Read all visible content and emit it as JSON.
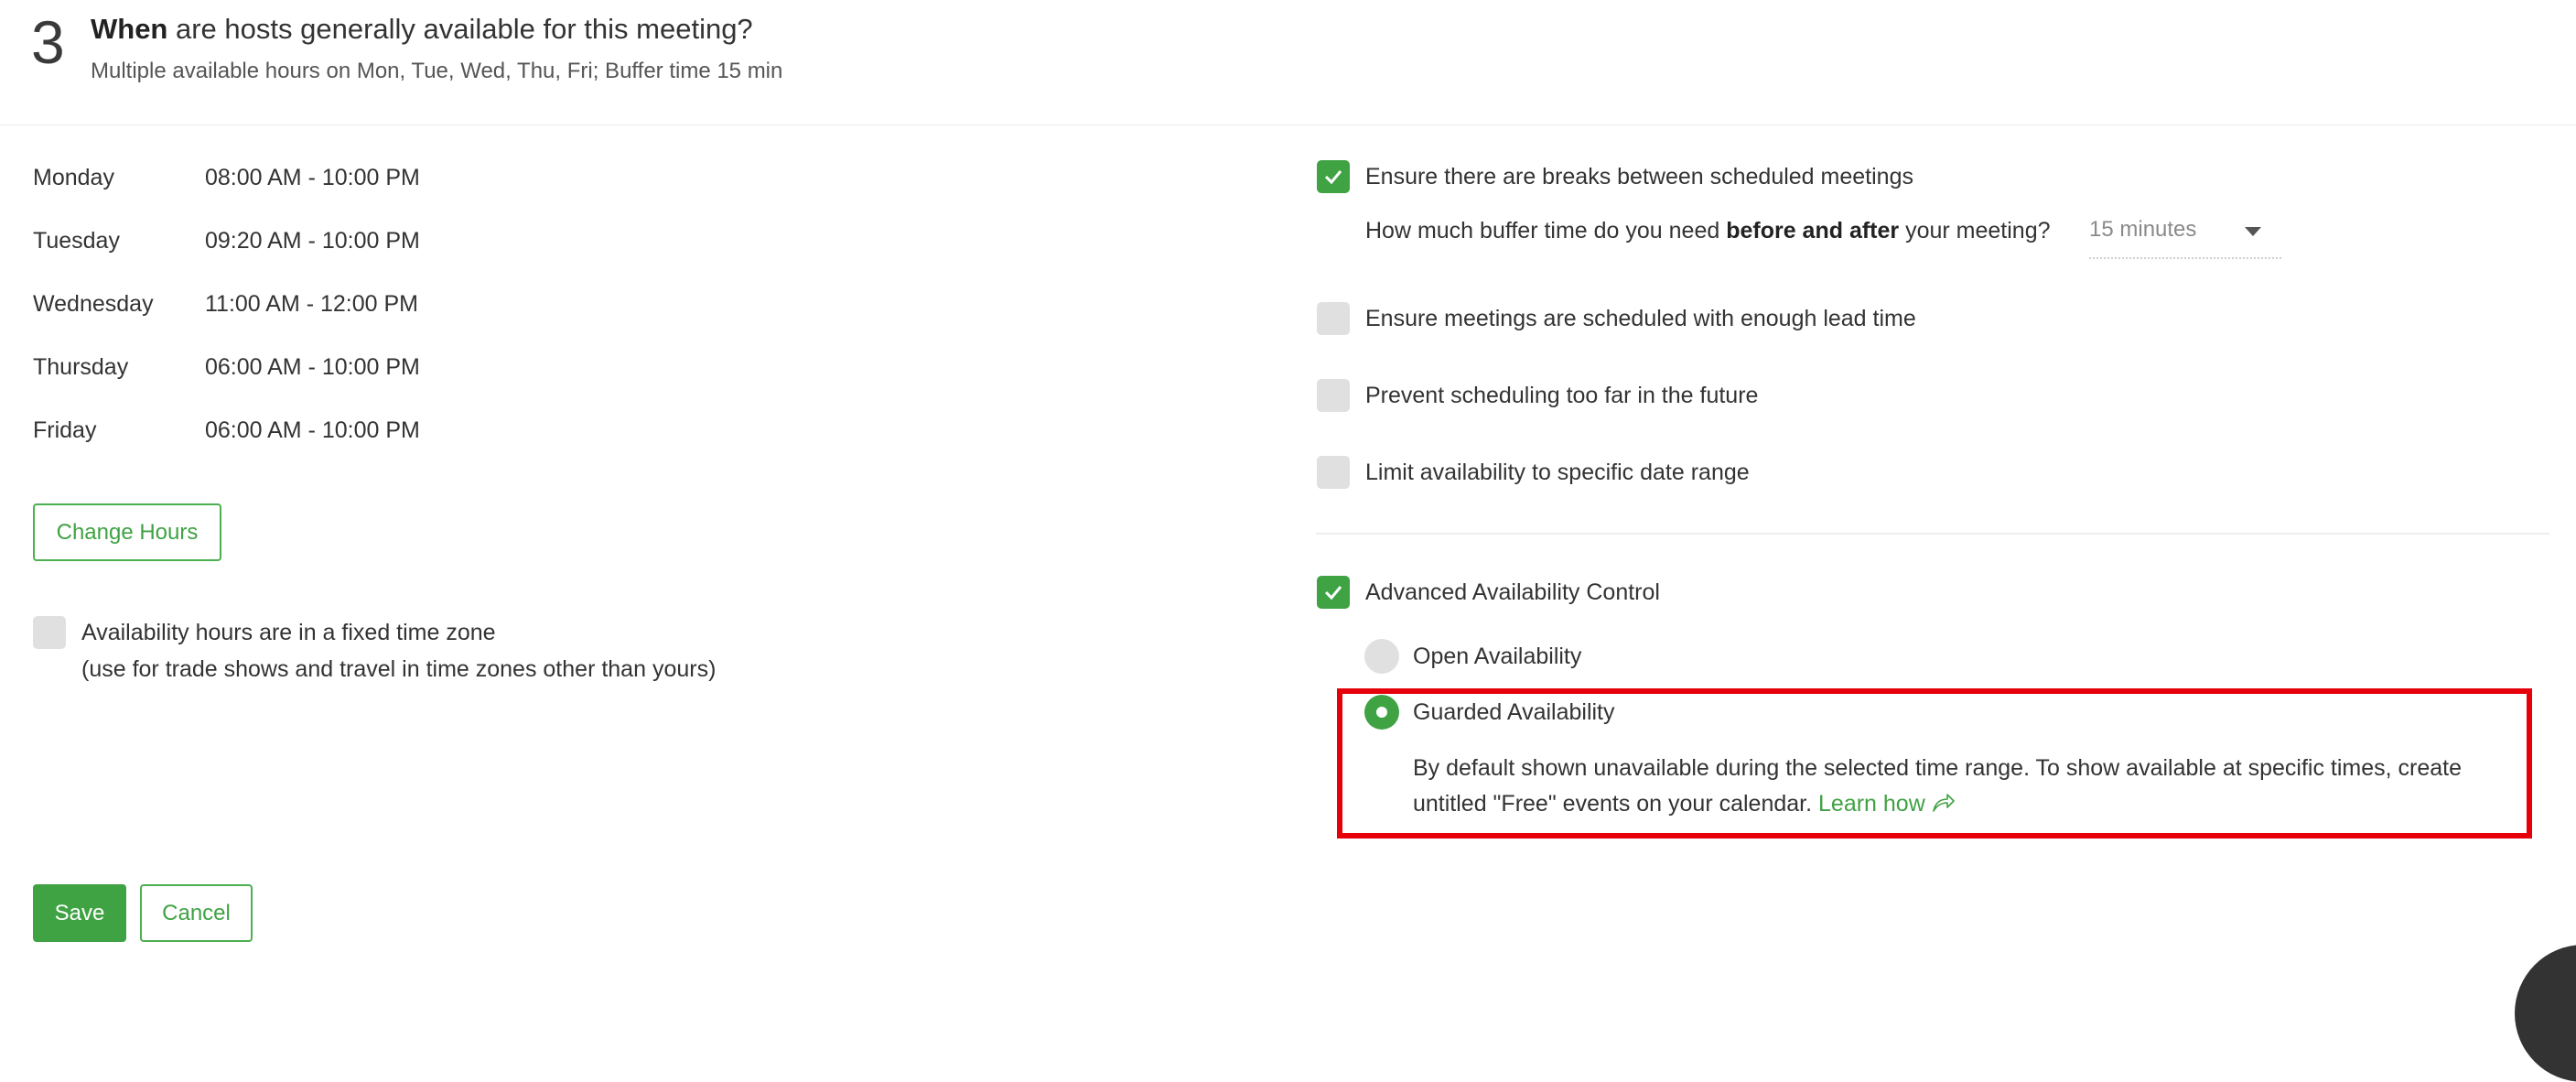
{
  "section": {
    "number": "3",
    "title_bold": "When",
    "title_rest": " are hosts generally available for this meeting?",
    "subtitle": "Multiple available hours on Mon, Tue, Wed, Thu, Fri; Buffer time 15 min"
  },
  "hours": [
    {
      "day": "Monday",
      "time": "08:00 AM - 10:00 PM"
    },
    {
      "day": "Tuesday",
      "time": "09:20 AM - 10:00 PM"
    },
    {
      "day": "Wednesday",
      "time": "11:00 AM - 12:00 PM"
    },
    {
      "day": "Thursday",
      "time": "06:00 AM - 10:00 PM"
    },
    {
      "day": "Friday",
      "time": "06:00 AM - 10:00 PM"
    }
  ],
  "change_hours_label": "Change Hours",
  "fixed_tz": {
    "checked": false,
    "label": "Availability hours are in a fixed time zone",
    "sublabel": "(use for trade shows and travel in time zones other than yours)"
  },
  "actions": {
    "save_label": "Save",
    "cancel_label": "Cancel"
  },
  "options": {
    "breaks": {
      "checked": true,
      "label": "Ensure there are breaks between scheduled meetings",
      "buffer_prefix": "How much buffer time do you need ",
      "buffer_bold": "before and after",
      "buffer_suffix": " your meeting?",
      "buffer_value": "15 minutes"
    },
    "lead_time": {
      "checked": false,
      "label": "Ensure meetings are scheduled with enough lead time"
    },
    "future": {
      "checked": false,
      "label": "Prevent scheduling too far in the future"
    },
    "date_range": {
      "checked": false,
      "label": "Limit availability to specific date range"
    }
  },
  "advanced": {
    "checked": true,
    "label": "Advanced Availability Control",
    "open_label": "Open Availability",
    "guarded_label": "Guarded Availability",
    "selected": "Guarded Availability",
    "description": "By default shown unavailable during the selected time range. To show available at specific times, create untitled \"Free\" events on your calendar.",
    "learn_how": "Learn how"
  },
  "colors": {
    "accent": "#3fa243",
    "highlight": "#e6000a"
  },
  "icons": {
    "check": "check-icon",
    "share": "share-arrow-icon",
    "caret": "chevron-down-icon"
  }
}
